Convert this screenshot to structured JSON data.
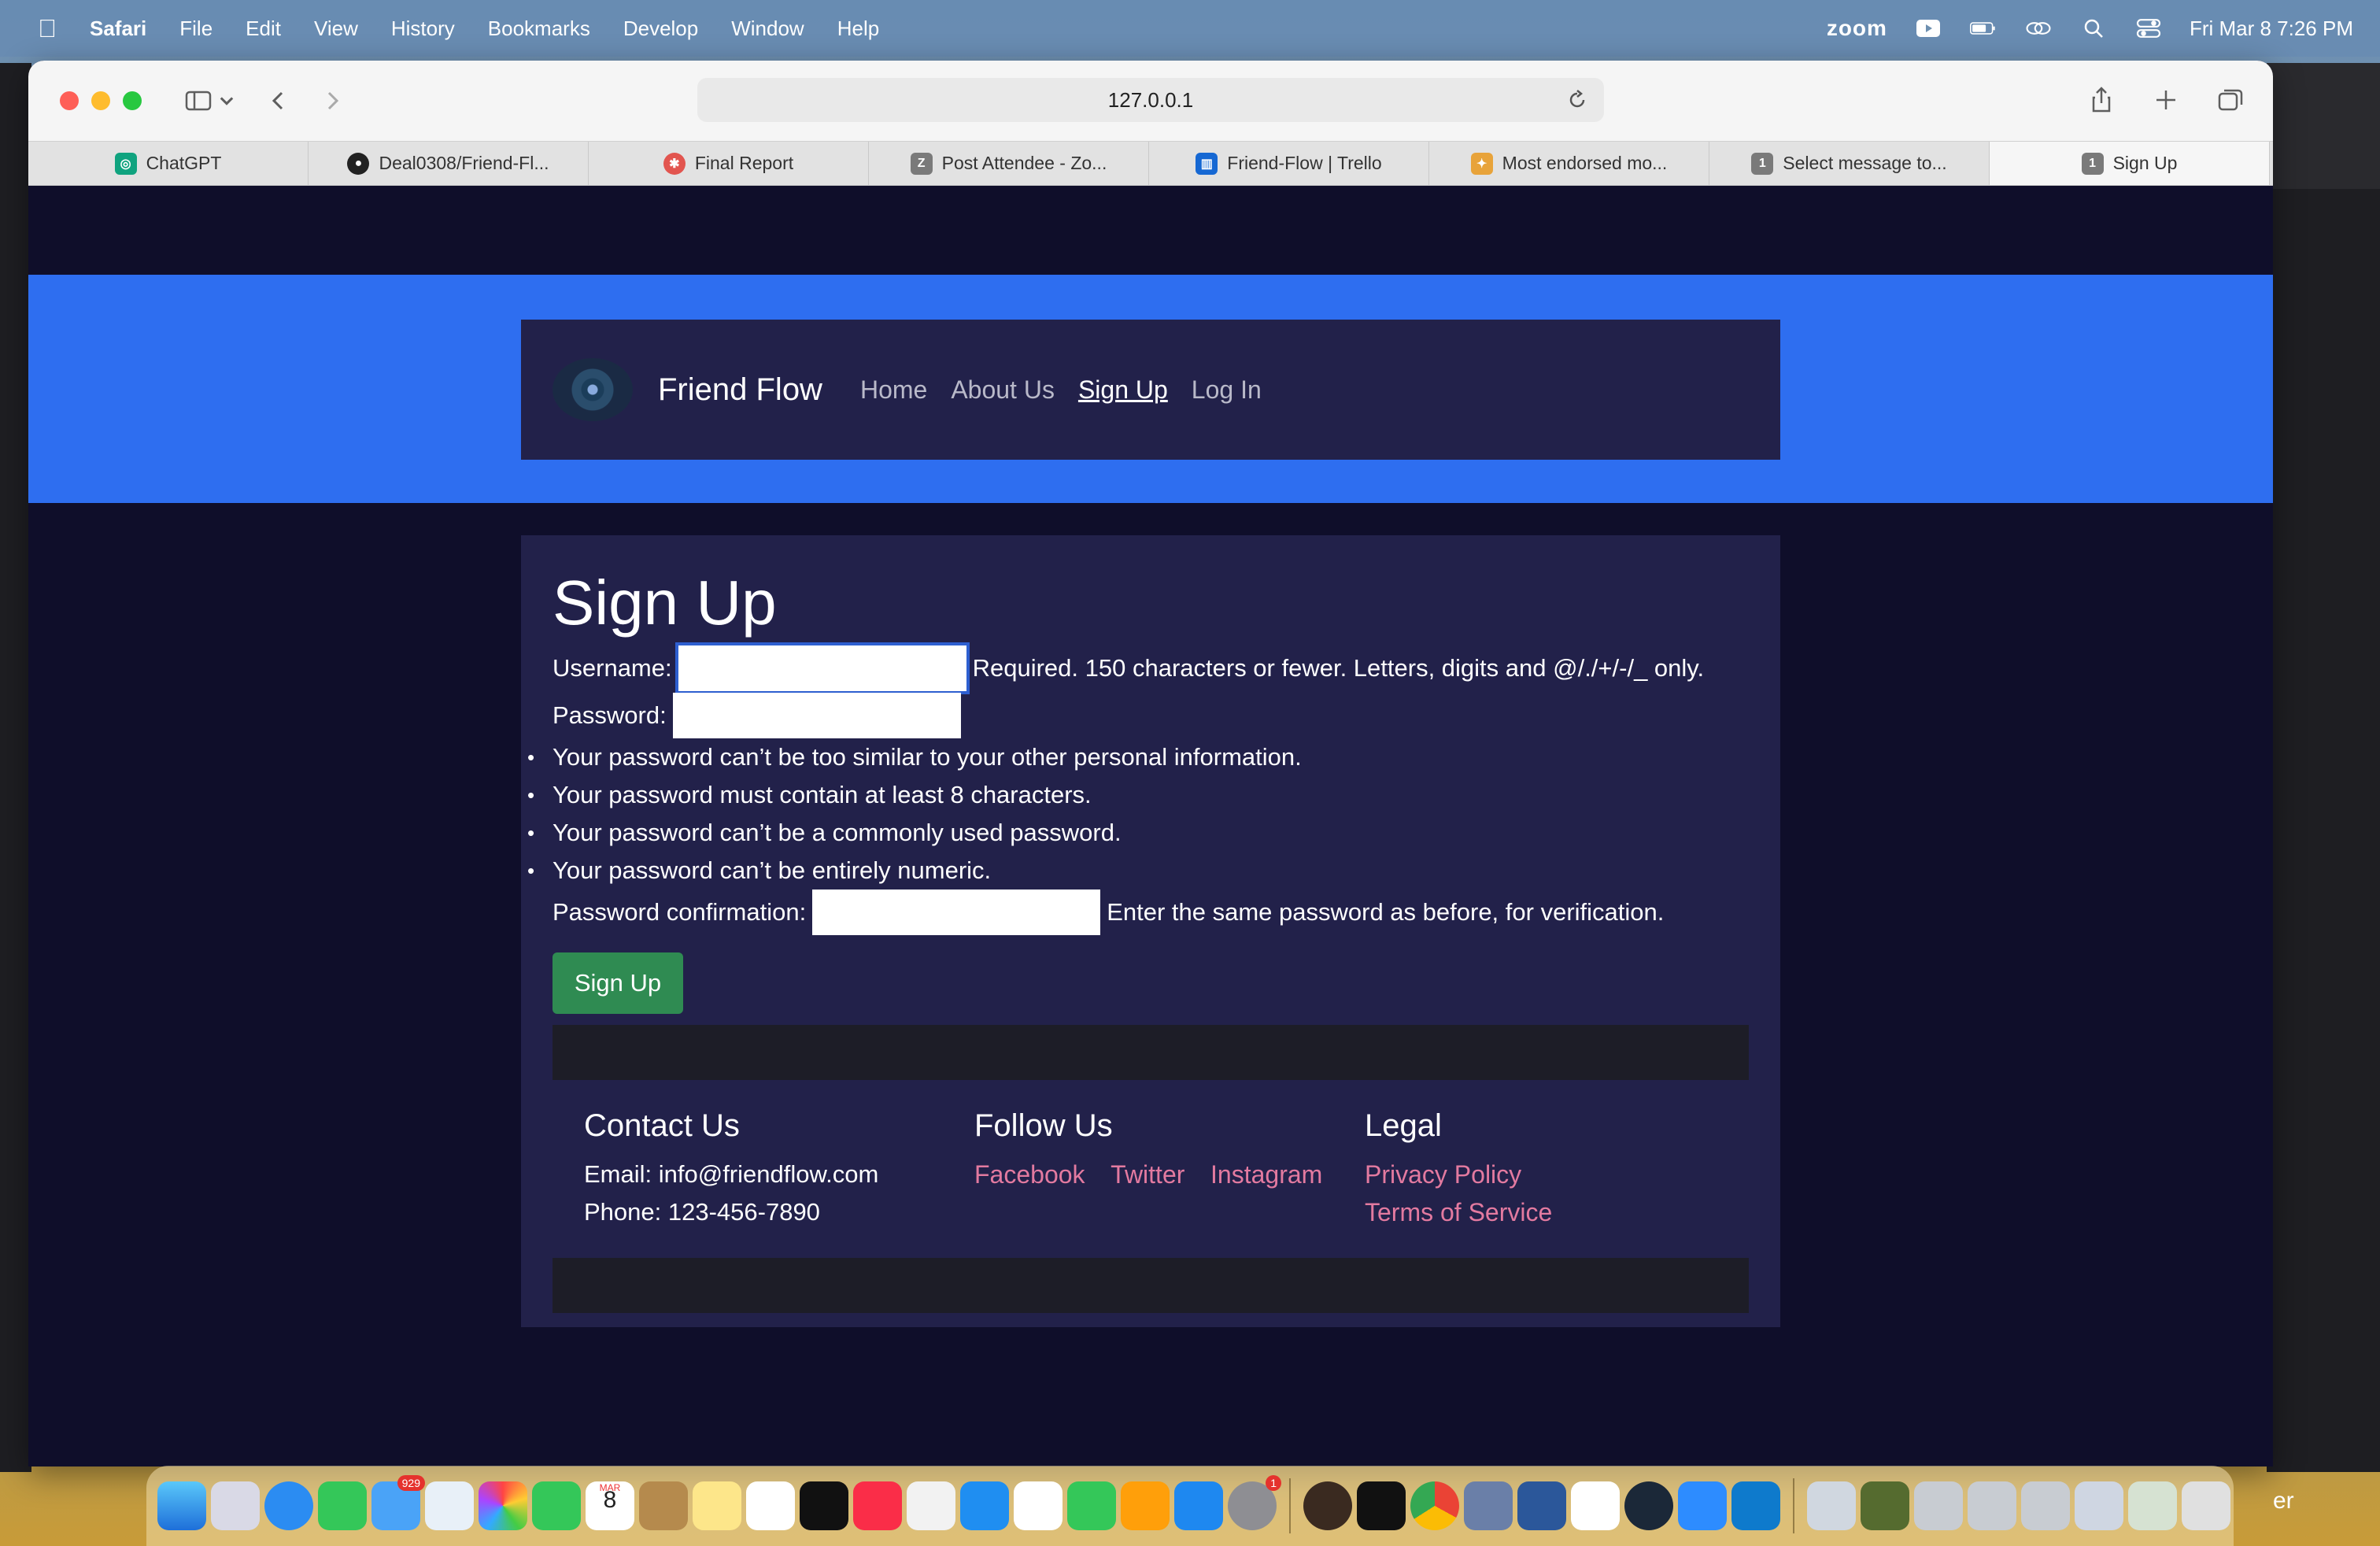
{
  "menubar": {
    "app_name": "Safari",
    "menus": [
      "File",
      "Edit",
      "View",
      "History",
      "Bookmarks",
      "Develop",
      "Window",
      "Help"
    ],
    "zoom_label": "zoom",
    "datetime": "Fri Mar 8  7:26 PM"
  },
  "browser": {
    "url": "127.0.0.1",
    "tabs": [
      {
        "label": "ChatGPT",
        "icon": "chatgpt-icon",
        "color": "#10a37f"
      },
      {
        "label": "Deal0308/Friend-Fl...",
        "icon": "github-icon",
        "color": "#222222"
      },
      {
        "label": "Final Report",
        "icon": "report-icon",
        "color": "#e2554f"
      },
      {
        "label": "Post Attendee - Zo...",
        "icon": "z-icon",
        "color": "#7a7a7a"
      },
      {
        "label": "Friend-Flow | Trello",
        "icon": "trello-icon",
        "color": "#1668d3"
      },
      {
        "label": "Most endorsed mo...",
        "icon": "endorsed-icon",
        "color": "#e8a33a"
      },
      {
        "label": "Select message to...",
        "icon": "one-icon",
        "color": "#7a7a7a"
      },
      {
        "label": "Sign Up",
        "icon": "one-icon",
        "color": "#7a7a7a"
      }
    ],
    "active_tab": "Sign Up"
  },
  "site": {
    "brand": "Friend Flow",
    "nav": [
      "Home",
      "About Us",
      "Sign Up",
      "Log In"
    ],
    "active_nav": "Sign Up"
  },
  "form": {
    "title": "Sign Up",
    "username_label": "Username:",
    "username_help": "Required. 150 characters or fewer. Letters, digits and @/./+/-/_ only.",
    "password_label": "Password:",
    "password_rules": [
      "Your password can’t be too similar to your other personal information.",
      "Your password must contain at least 8 characters.",
      "Your password can’t be a commonly used password.",
      "Your password can’t be entirely numeric."
    ],
    "confirm_label": "Password confirmation:",
    "confirm_help": "Enter the same password as before, for verification.",
    "submit_label": "Sign Up",
    "username_value": "",
    "password_value": "",
    "confirm_value": ""
  },
  "footer": {
    "contact_title": "Contact Us",
    "email": "Email: info@friendflow.com",
    "phone": "Phone: 123-456-7890",
    "follow_title": "Follow Us",
    "social": [
      "Facebook",
      "Twitter",
      "Instagram"
    ],
    "legal_title": "Legal",
    "legal": [
      "Privacy Policy",
      "Terms of Service"
    ]
  },
  "colors": {
    "page_bg": "#0f0e2a",
    "band": "#2e6ef0",
    "card": "#22214a",
    "button": "#2f8b52",
    "link": "#e37aa0"
  },
  "desktop": {
    "right_window_text": "er"
  },
  "dock": {
    "mail_badge": "929",
    "calendar_month": "MAR",
    "calendar_day": "8",
    "settings_badge": "1"
  }
}
